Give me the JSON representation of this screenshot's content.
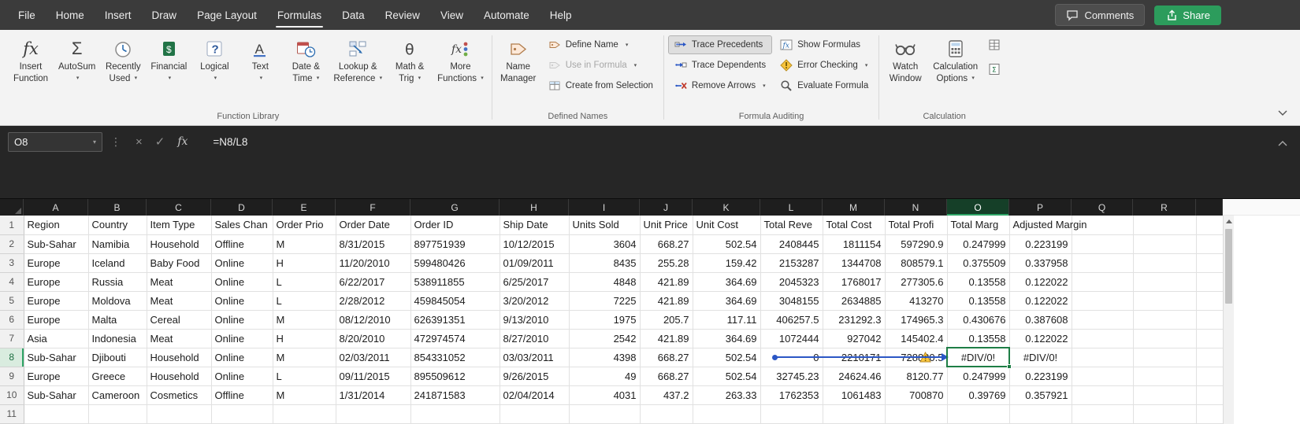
{
  "menu_bar": {
    "items": [
      "File",
      "Home",
      "Insert",
      "Draw",
      "Page Layout",
      "Formulas",
      "Data",
      "Review",
      "View",
      "Automate",
      "Help"
    ],
    "active": "Formulas",
    "comments_label": "Comments",
    "share_label": "Share"
  },
  "ribbon": {
    "groups": [
      {
        "name": "Function Library",
        "big_buttons": [
          {
            "id": "insert-function",
            "icon": "insert-function-icon",
            "line1": "Insert",
            "line2": "Function",
            "dropdown": false
          },
          {
            "id": "autosum",
            "icon": "autosum-icon",
            "line1": "AutoSum",
            "line2": "",
            "dropdown": true
          },
          {
            "id": "recently-used",
            "icon": "recently-used-icon",
            "line1": "Recently",
            "line2": "Used",
            "dropdown": true
          },
          {
            "id": "financial",
            "icon": "financial-icon",
            "line1": "Financial",
            "line2": "",
            "dropdown": true
          },
          {
            "id": "logical",
            "icon": "logical-icon",
            "line1": "Logical",
            "line2": "",
            "dropdown": true
          },
          {
            "id": "text",
            "icon": "text-icon",
            "line1": "Text",
            "line2": "",
            "dropdown": true
          },
          {
            "id": "date-time",
            "icon": "date-time-icon",
            "line1": "Date &",
            "line2": "Time",
            "dropdown": true
          },
          {
            "id": "lookup-reference",
            "icon": "lookup-reference-icon",
            "line1": "Lookup &",
            "line2": "Reference",
            "dropdown": true
          },
          {
            "id": "math-trig",
            "icon": "math-trig-icon",
            "line1": "Math &",
            "line2": "Trig",
            "dropdown": true
          },
          {
            "id": "more-functions",
            "icon": "more-functions-icon",
            "line1": "More",
            "line2": "Functions",
            "dropdown": true
          }
        ]
      },
      {
        "name": "Defined Names",
        "big_buttons": [
          {
            "id": "name-manager",
            "icon": "name-manager-icon",
            "line1": "Name",
            "line2": "Manager",
            "dropdown": false
          }
        ],
        "small_buttons": [
          {
            "id": "define-name",
            "icon": "define-name-icon",
            "label": "Define Name",
            "dropdown": true
          },
          {
            "id": "use-in-formula",
            "icon": "use-in-formula-icon",
            "label": "Use in Formula",
            "dropdown": true,
            "disabled": true
          },
          {
            "id": "create-from-selection",
            "icon": "create-from-selection-icon",
            "label": "Create from Selection",
            "dropdown": false
          }
        ]
      },
      {
        "name": "Formula Auditing",
        "small_columns": [
          [
            {
              "id": "trace-precedents",
              "icon": "trace-precedents-icon",
              "label": "Trace Precedents",
              "active": true
            },
            {
              "id": "trace-dependents",
              "icon": "trace-dependents-icon",
              "label": "Trace Dependents"
            },
            {
              "id": "remove-arrows",
              "icon": "remove-arrows-icon",
              "label": "Remove Arrows",
              "dropdown": true
            }
          ],
          [
            {
              "id": "show-formulas",
              "icon": "show-formulas-icon",
              "label": "Show Formulas"
            },
            {
              "id": "error-checking",
              "icon": "error-checking-icon",
              "label": "Error Checking",
              "dropdown": true
            },
            {
              "id": "evaluate-formula",
              "icon": "evaluate-formula-icon",
              "label": "Evaluate Formula"
            }
          ]
        ]
      },
      {
        "name": "Calculation",
        "big_buttons": [
          {
            "id": "watch-window",
            "icon": "watch-window-icon",
            "line1": "Watch",
            "line2": "Window",
            "dropdown": false
          },
          {
            "id": "calculation-options",
            "icon": "calculation-options-icon",
            "line1": "Calculation",
            "line2": "Options",
            "dropdown": true
          }
        ],
        "icon_buttons": [
          {
            "id": "calculate-now",
            "icon": "calculate-now-icon"
          },
          {
            "id": "calculate-sheet",
            "icon": "calculate-sheet-icon"
          }
        ]
      }
    ]
  },
  "formula_bar": {
    "name_box": "O8",
    "formula": "=N8/L8"
  },
  "grid": {
    "column_letters": [
      "A",
      "B",
      "C",
      "D",
      "E",
      "F",
      "G",
      "H",
      "I",
      "J",
      "K",
      "L",
      "M",
      "N",
      "O",
      "P",
      "Q",
      "R"
    ],
    "selected_column": "O",
    "selected_row": 8,
    "active_cell": {
      "ref": "O8",
      "value": "#DIV/0!"
    },
    "trace": {
      "type": "precedents-arrow",
      "from_cell": "L8",
      "to_cell": "O8"
    },
    "col_align": [
      "l",
      "l",
      "l",
      "l",
      "l",
      "l",
      "l",
      "l",
      "r",
      "r",
      "r",
      "r",
      "r",
      "r",
      "r",
      "r",
      "l",
      "l"
    ],
    "rows": [
      {
        "num": 1,
        "header_row": true,
        "cells": [
          "Region",
          "Country",
          "Item Type",
          "Sales Chan",
          "Order Prio",
          "Order Date",
          "Order ID",
          "Ship Date",
          "Units Sold",
          "Unit Price",
          "Unit Cost",
          "Total Reve",
          "Total Cost",
          "Total Profi",
          "Total Marg",
          {
            "value": "Adjusted Margin",
            "spill": true
          },
          "",
          ""
        ]
      },
      {
        "num": 2,
        "cells": [
          "Sub-Sahar",
          "Namibia",
          "Household",
          "Offline",
          "M",
          "8/31/2015",
          "897751939",
          "10/12/2015",
          "3604",
          "668.27",
          "502.54",
          "2408445",
          "1811154",
          "597290.9",
          "0.247999",
          "0.223199",
          "",
          ""
        ]
      },
      {
        "num": 3,
        "cells": [
          "Europe",
          "Iceland",
          "Baby Food",
          "Online",
          "H",
          "11/20/2010",
          "599480426",
          "01/09/2011",
          "8435",
          "255.28",
          "159.42",
          "2153287",
          "1344708",
          "808579.1",
          "0.375509",
          "0.337958",
          "",
          ""
        ]
      },
      {
        "num": 4,
        "cells": [
          "Europe",
          "Russia",
          "Meat",
          "Online",
          "L",
          "6/22/2017",
          "538911855",
          "6/25/2017",
          "4848",
          "421.89",
          "364.69",
          "2045323",
          "1768017",
          "277305.6",
          "0.13558",
          "0.122022",
          "",
          ""
        ]
      },
      {
        "num": 5,
        "cells": [
          "Europe",
          "Moldova",
          "Meat",
          "Online",
          "L",
          "2/28/2012",
          "459845054",
          "3/20/2012",
          "7225",
          "421.89",
          "364.69",
          "3048155",
          "2634885",
          "413270",
          "0.13558",
          "0.122022",
          "",
          ""
        ]
      },
      {
        "num": 6,
        "cells": [
          "Europe",
          "Malta",
          "Cereal",
          "Online",
          "M",
          "08/12/2010",
          "626391351",
          "9/13/2010",
          "1975",
          "205.7",
          "117.11",
          "406257.5",
          "231292.3",
          "174965.3",
          "0.430676",
          "0.387608",
          "",
          ""
        ]
      },
      {
        "num": 7,
        "cells": [
          "Asia",
          "Indonesia",
          "Meat",
          "Online",
          "H",
          "8/20/2010",
          "472974574",
          "8/27/2010",
          "2542",
          "421.89",
          "364.69",
          "1072444",
          "927042",
          "145402.4",
          "0.13558",
          "0.122022",
          "",
          ""
        ]
      },
      {
        "num": 8,
        "cells": [
          "Sub-Sahar",
          "Djibouti",
          "Household",
          "Online",
          "M",
          "02/03/2011",
          "854331052",
          "03/03/2011",
          "4398",
          "668.27",
          "502.54",
          {
            "value": "0",
            "trace_origin": true
          },
          "2210171",
          {
            "value": "728880.5",
            "warning": true
          },
          {
            "value": "#DIV/0!",
            "error": true,
            "selected": true
          },
          {
            "value": "#DIV/0!",
            "error": true
          },
          "",
          ""
        ]
      },
      {
        "num": 9,
        "cells": [
          "Europe",
          "Greece",
          "Household",
          "Online",
          "L",
          "09/11/2015",
          "895509612",
          "9/26/2015",
          "49",
          "668.27",
          "502.54",
          "32745.23",
          "24624.46",
          "8120.77",
          "0.247999",
          "0.223199",
          "",
          ""
        ]
      },
      {
        "num": 10,
        "cells": [
          "Sub-Sahar",
          "Cameroon",
          "Cosmetics",
          "Offline",
          "M",
          "1/31/2014",
          "241871583",
          "02/04/2014",
          "4031",
          "437.2",
          "263.33",
          "1762353",
          "1061483",
          "700870",
          "0.39769",
          "0.357921",
          "",
          ""
        ]
      },
      {
        "num": 11,
        "cells": [
          "",
          "",
          "",
          "",
          "",
          "",
          "",
          "",
          "",
          "",
          "",
          "",
          "",
          "",
          "",
          "",
          "",
          ""
        ]
      }
    ]
  },
  "colors": {
    "excel_green": "#217346",
    "selection_border": "#1e7e45",
    "trace_arrow_blue": "#2b57c5",
    "warning_yellow": "#f7c33c",
    "share_button_green": "#2c9c5c"
  }
}
